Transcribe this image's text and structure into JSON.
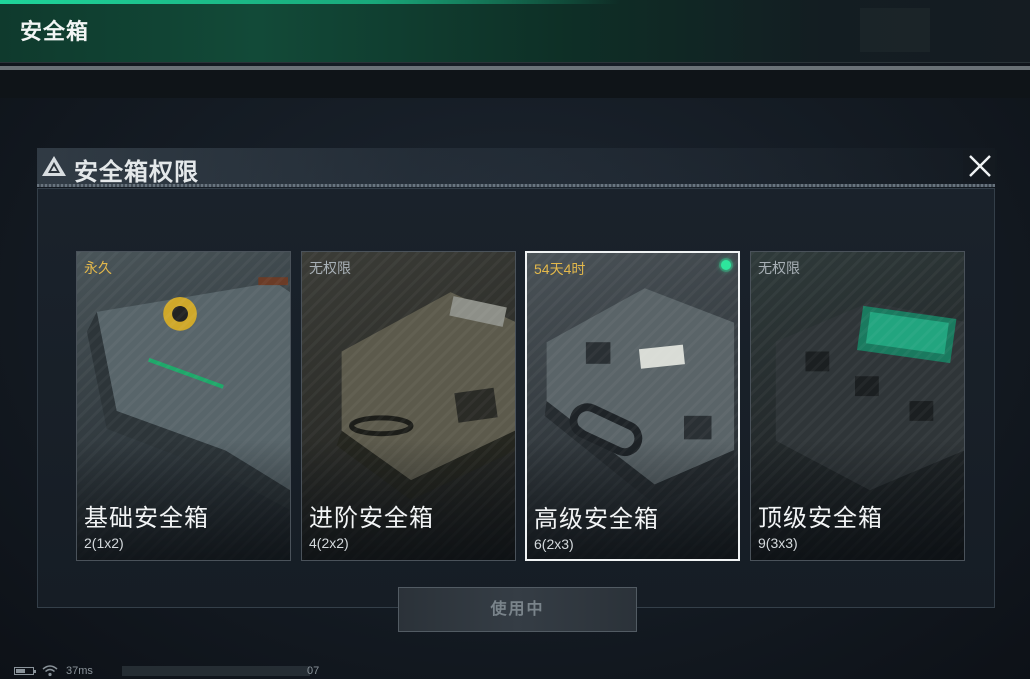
{
  "header": {
    "title": "安全箱"
  },
  "modal": {
    "title": "安全箱权限",
    "cards": [
      {
        "status": "永久",
        "name": "基础安全箱",
        "size": "2(1x2)",
        "selected": false
      },
      {
        "status": "无权限",
        "name": "进阶安全箱",
        "size": "4(2x2)",
        "selected": false
      },
      {
        "status": "54天4时",
        "name": "高级安全箱",
        "size": "6(2x3)",
        "selected": true
      },
      {
        "status": "无权限",
        "name": "顶级安全箱",
        "size": "9(3x3)",
        "selected": false
      }
    ],
    "action_label": "使用中"
  },
  "statusbar": {
    "ping": "37ms",
    "tail": "07"
  },
  "colors": {
    "accent_green": "#1fd49a",
    "gold": "#e3b84b",
    "active_dot": "#2ee69c"
  },
  "icons": [
    "warning-triangle-icon",
    "close-icon",
    "battery-icon",
    "wifi-icon",
    "active-dot-icon"
  ]
}
